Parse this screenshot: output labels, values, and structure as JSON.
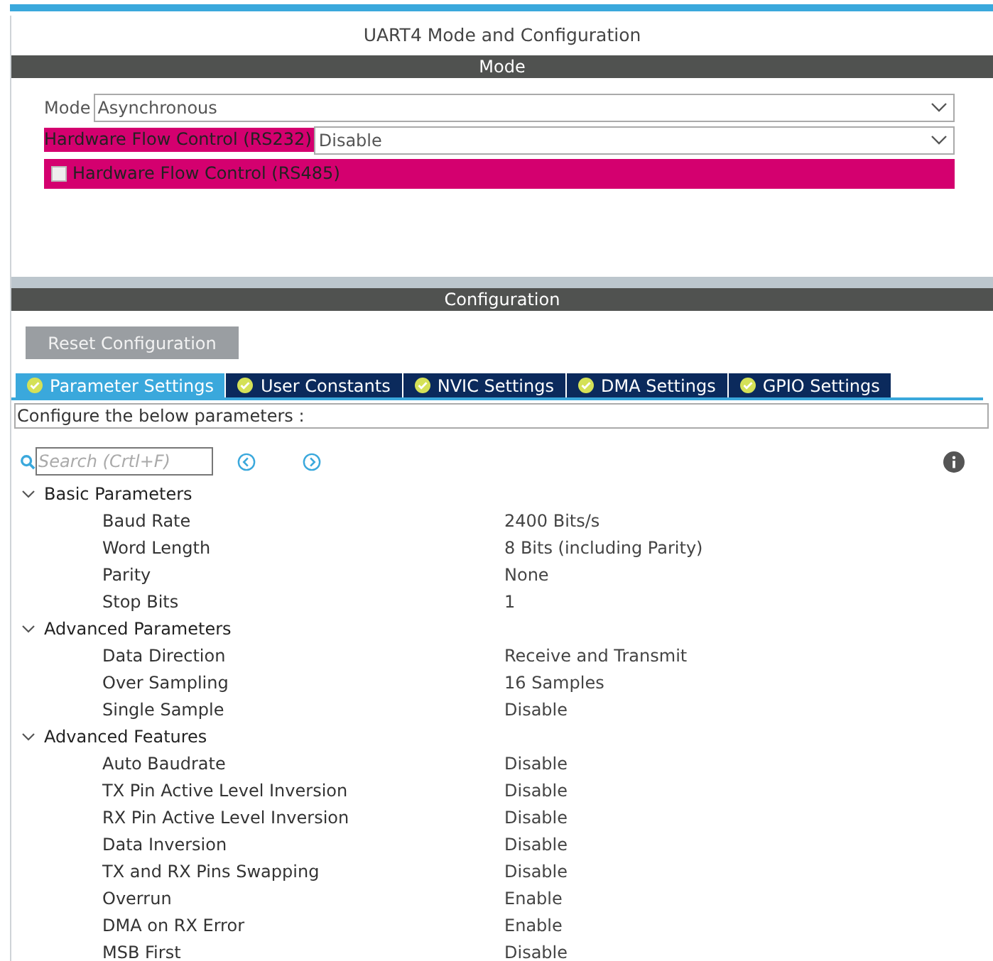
{
  "window": {
    "title": "UART4 Mode and Configuration"
  },
  "mode_section": {
    "title": "Mode",
    "mode": {
      "label": "Mode",
      "value": "Asynchronous"
    },
    "flow_rs232": {
      "label": "Hardware Flow Control (RS232)",
      "value": "Disable"
    },
    "flow_rs485": {
      "label": "Hardware Flow Control (RS485)",
      "checked": false
    }
  },
  "config_section": {
    "title": "Configuration",
    "reset_button": "Reset Configuration",
    "tabs": [
      {
        "label": "Parameter Settings",
        "selected": true
      },
      {
        "label": "User Constants",
        "selected": false
      },
      {
        "label": "NVIC Settings",
        "selected": false
      },
      {
        "label": "DMA Settings",
        "selected": false
      },
      {
        "label": "GPIO Settings",
        "selected": false
      }
    ],
    "description": "Configure the below parameters :",
    "search": {
      "placeholder": "Search (Crtl+F)"
    },
    "groups": [
      {
        "name": "Basic Parameters",
        "expanded": true,
        "children": [
          {
            "name": "Baud Rate",
            "value": "2400 Bits/s"
          },
          {
            "name": "Word Length",
            "value": "8 Bits (including Parity)"
          },
          {
            "name": "Parity",
            "value": "None"
          },
          {
            "name": "Stop Bits",
            "value": "1"
          }
        ]
      },
      {
        "name": "Advanced Parameters",
        "expanded": true,
        "children": [
          {
            "name": "Data Direction",
            "value": "Receive and Transmit"
          },
          {
            "name": "Over Sampling",
            "value": "16 Samples"
          },
          {
            "name": "Single Sample",
            "value": "Disable"
          }
        ]
      },
      {
        "name": "Advanced Features",
        "expanded": true,
        "children": [
          {
            "name": "Auto Baudrate",
            "value": "Disable"
          },
          {
            "name": "TX Pin Active Level Inversion",
            "value": "Disable"
          },
          {
            "name": "RX Pin Active Level Inversion",
            "value": "Disable"
          },
          {
            "name": "Data Inversion",
            "value": "Disable"
          },
          {
            "name": "TX and RX Pins Swapping",
            "value": "Disable"
          },
          {
            "name": "Overrun",
            "value": "Enable"
          },
          {
            "name": "DMA on RX Error",
            "value": "Enable"
          },
          {
            "name": "MSB First",
            "value": "Disable"
          }
        ]
      }
    ]
  }
}
